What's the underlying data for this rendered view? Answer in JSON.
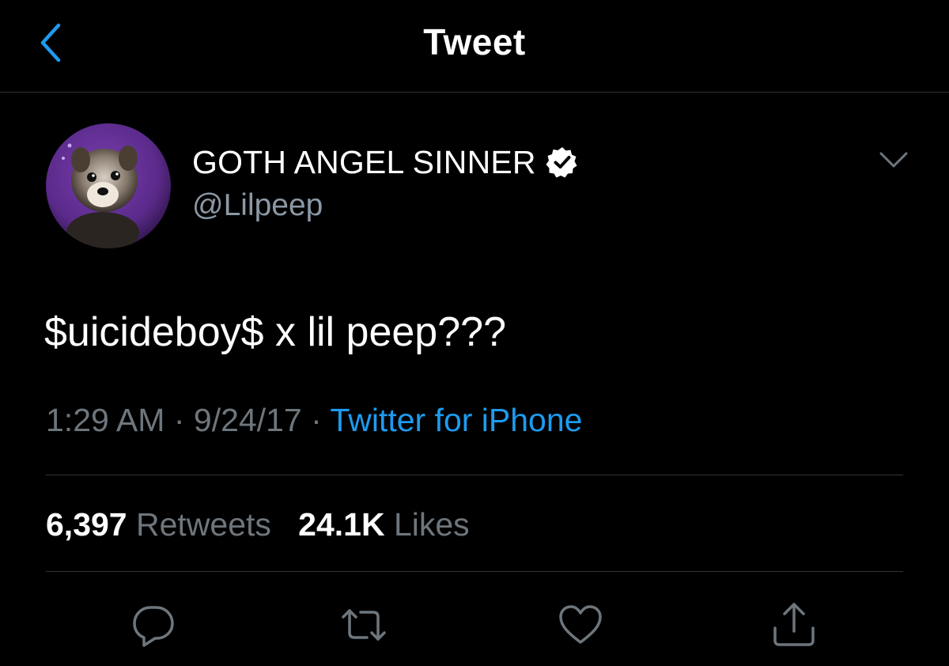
{
  "nav": {
    "title": "Tweet",
    "back_icon": "chevron-left-icon"
  },
  "author": {
    "display_name": "GOTH ANGEL SINNER",
    "handle": "@Lilpeep",
    "verified": true,
    "avatar_bg_color": "#5a2a8a"
  },
  "tweet": {
    "text": "$uicideboy$ x lil peep???",
    "time": "1:29 AM",
    "separator": "·",
    "date": "9/24/17",
    "source": "Twitter for iPhone"
  },
  "stats": {
    "retweets_count": "6,397",
    "retweets_label": "Retweets",
    "likes_count": "24.1K",
    "likes_label": "Likes"
  },
  "actions": [
    "reply-icon",
    "retweet-icon",
    "like-icon",
    "share-icon"
  ],
  "colors": {
    "background": "#000000",
    "accent": "#1d9bf0",
    "secondary_text": "#6e767d",
    "divider": "#2f3336"
  }
}
